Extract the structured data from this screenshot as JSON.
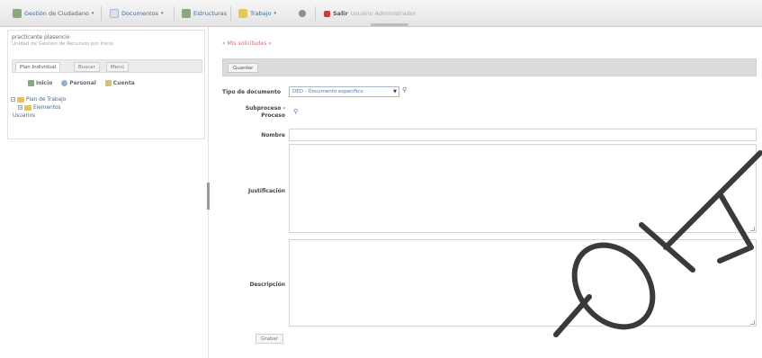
{
  "toolbar": {
    "items": [
      {
        "label": "Gestión de Ciudadano",
        "icon": "people-icon",
        "color": "#7a9a6a"
      },
      {
        "label": "Documentos",
        "icon": "document-icon",
        "color": "#b8c8d8"
      },
      {
        "label": "Estructuras",
        "icon": "structure-icon",
        "color": "#7a9a6a"
      },
      {
        "label": "Trabajo",
        "icon": "briefcase-icon",
        "color": "#e0c24a"
      },
      {
        "label": "",
        "icon": "gear-icon",
        "color": "#6a8a6a"
      },
      {
        "label": "Salir",
        "icon": "exit-icon",
        "color": "#cc3b3b"
      }
    ],
    "user_info": "Usuario Administrador"
  },
  "left": {
    "user_name": "practicante plasencio",
    "user_sub": "Unidad de Gestión de Recursos por Inicio",
    "tabs": [
      "Plan Individual",
      "Buscar",
      "Menú"
    ],
    "buttons": [
      "Inicio",
      "Personal",
      "Cuenta"
    ],
    "tree": [
      "Plan de Trabajo",
      "Elementos",
      "Usuarios"
    ]
  },
  "form": {
    "breadcrumb": "« Mis solicitudes »",
    "save_label": "Guardar",
    "doc_type_label": "Tipo de documento",
    "doc_type_value": "DED - Documento específico",
    "subprocess_label": "Subproceso - Proceso",
    "name_label": "Nombre",
    "justification_label": "Justificación",
    "description_label": "Descripción",
    "submit_label": "Grabar"
  },
  "colors": {
    "accent": "#4a6a8a",
    "breadcrumb": "#d86a6a",
    "section_bar": "#dcdcdc"
  }
}
